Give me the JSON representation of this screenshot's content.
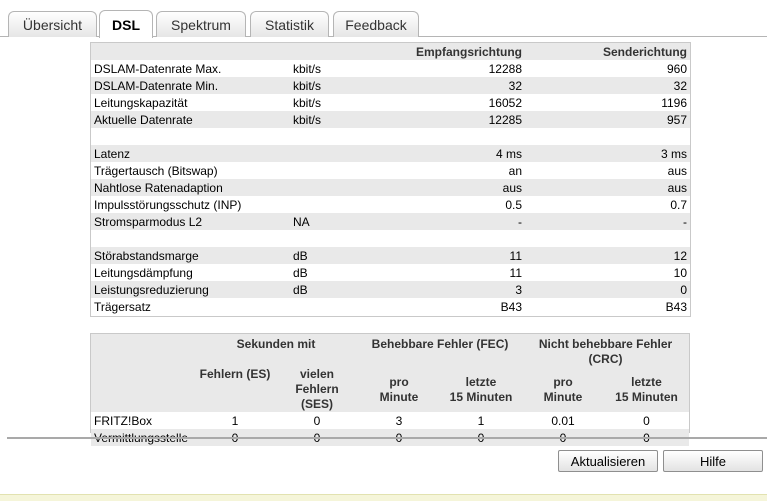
{
  "tabs": [
    {
      "label": "Übersicht"
    },
    {
      "label": "DSL"
    },
    {
      "label": "Spektrum"
    },
    {
      "label": "Statistik"
    },
    {
      "label": "Feedback"
    }
  ],
  "overview": {
    "header": {
      "label": "",
      "unit": "",
      "rx": "Empfangsrichtung",
      "tx": "Senderichtung"
    },
    "rows": [
      {
        "label": "DSLAM-Datenrate Max.",
        "unit": "kbit/s",
        "rx": "12288",
        "tx": "960"
      },
      {
        "label": "DSLAM-Datenrate Min.",
        "unit": "kbit/s",
        "rx": "32",
        "tx": "32"
      },
      {
        "label": "Leitungskapazität",
        "unit": "kbit/s",
        "rx": "16052",
        "tx": "1196"
      },
      {
        "label": "Aktuelle Datenrate",
        "unit": "kbit/s",
        "rx": "12285",
        "tx": "957"
      },
      {
        "label": "",
        "unit": "",
        "rx": "",
        "tx": ""
      },
      {
        "label": "Latenz",
        "unit": "",
        "rx": "4 ms",
        "tx": "3 ms"
      },
      {
        "label": "Trägertausch (Bitswap)",
        "unit": "",
        "rx": "an",
        "tx": "aus"
      },
      {
        "label": "Nahtlose Ratenadaption",
        "unit": "",
        "rx": "aus",
        "tx": "aus"
      },
      {
        "label": "Impulsstörungsschutz (INP)",
        "unit": "",
        "rx": "0.5",
        "tx": "0.7"
      },
      {
        "label": "Stromsparmodus L2",
        "unit": "NA",
        "rx": "-",
        "tx": "-"
      },
      {
        "label": "",
        "unit": "",
        "rx": "",
        "tx": ""
      },
      {
        "label": "Störabstandsmarge",
        "unit": "dB",
        "rx": "11",
        "tx": "12"
      },
      {
        "label": "Leitungsdämpfung",
        "unit": "dB",
        "rx": "11",
        "tx": "10"
      },
      {
        "label": "Leistungsreduzierung",
        "unit": "dB",
        "rx": "3",
        "tx": "0"
      },
      {
        "label": "Trägersatz",
        "unit": "",
        "rx": "B43",
        "tx": "B43"
      }
    ]
  },
  "errors": {
    "group_headers": {
      "seconds": "Sekunden mit",
      "fec": "Behebbare Fehler (FEC)",
      "crc_line1": "Nicht behebbare Fehler",
      "crc_line2": "(CRC)"
    },
    "sub_headers": {
      "es": "Fehlern (ES)",
      "ses_line1": "vielen",
      "ses_line2": "Fehlern (SES)",
      "fec_min_line1": "pro",
      "fec_min_line2": "Minute",
      "fec_15_line1": "letzte",
      "fec_15_line2": "15 Minuten",
      "crc_min_line1": "pro",
      "crc_min_line2": "Minute",
      "crc_15_line1": "letzte",
      "crc_15_line2": "15 Minuten"
    },
    "rows": [
      {
        "label": "FRITZ!Box",
        "es": "1",
        "ses": "0",
        "fec_min": "3",
        "fec_15": "1",
        "crc_min": "0.01",
        "crc_15": "0"
      },
      {
        "label": "Vermittlungsstelle",
        "es": "0",
        "ses": "0",
        "fec_min": "0",
        "fec_15": "0",
        "crc_min": "0",
        "crc_15": "0"
      }
    ]
  },
  "buttons": {
    "refresh": "Aktualisieren",
    "help": "Hilfe"
  }
}
